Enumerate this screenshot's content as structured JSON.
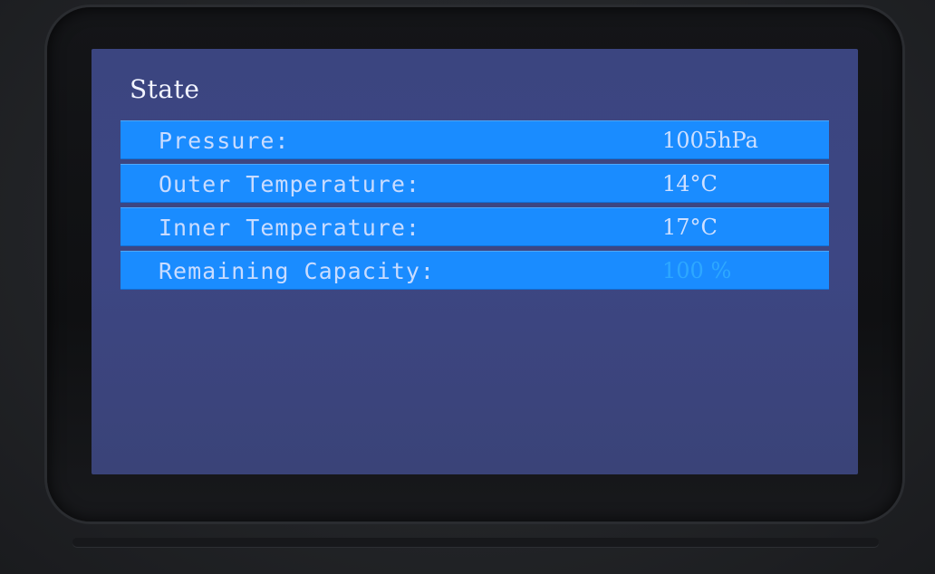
{
  "screen": {
    "title": "State",
    "rows": [
      {
        "label": "Pressure:",
        "value": "1005hPa"
      },
      {
        "label": "Outer Temperature:",
        "value": "14°C"
      },
      {
        "label": "Inner Temperature:",
        "value": "17°C"
      },
      {
        "label": "Remaining Capacity:",
        "value": "100 %"
      }
    ]
  },
  "colors": {
    "screen_background": "#3b4580",
    "row_highlight": "#1a8cff",
    "text": "#c9dcff",
    "dim_value": "#2ea8ff"
  }
}
